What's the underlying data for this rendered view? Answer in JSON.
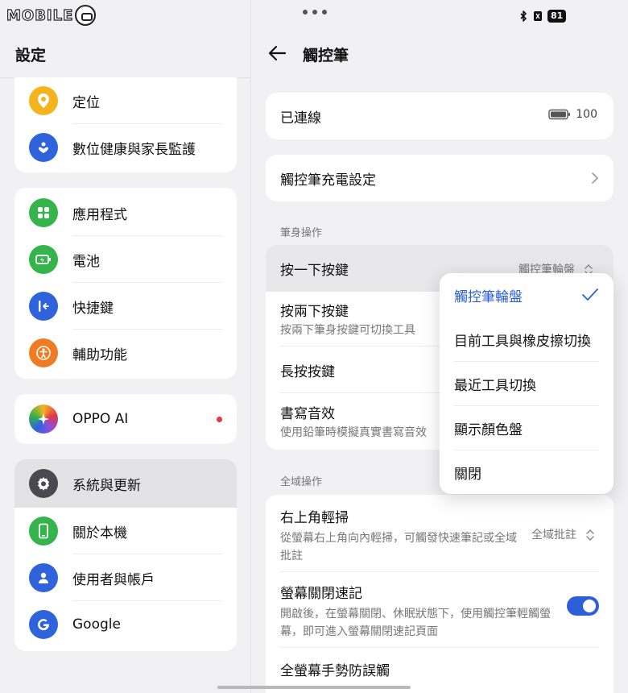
{
  "watermark": "MOBILE",
  "status": {
    "battery": "81"
  },
  "left": {
    "title": "設定",
    "groups": [
      {
        "items": [
          {
            "label": "定位",
            "icon": "location-icon",
            "color": "#f5b41e"
          },
          {
            "label": "數位健康與家長監護",
            "icon": "heart-icon",
            "color": "#2f63dc"
          }
        ]
      },
      {
        "items": [
          {
            "label": "應用程式",
            "icon": "apps-grid-icon",
            "color": "#34b44a"
          },
          {
            "label": "電池",
            "icon": "battery-icon",
            "color": "#34b44a"
          },
          {
            "label": "快捷鍵",
            "icon": "shortcut-icon",
            "color": "#2f63dc"
          },
          {
            "label": "輔助功能",
            "icon": "accessibility-icon",
            "color": "#f07b22"
          }
        ]
      },
      {
        "items": [
          {
            "label": "OPPO AI",
            "icon": "ai-sparkle-icon",
            "color": "#8a4fe0"
          }
        ]
      },
      {
        "items": [
          {
            "label": "系統與更新",
            "icon": "gear-icon",
            "color": "#4a4a4e"
          },
          {
            "label": "關於本機",
            "icon": "phone-icon",
            "color": "#34b44a"
          },
          {
            "label": "使用者與帳戶",
            "icon": "user-icon",
            "color": "#2f63dc"
          },
          {
            "label": "Google",
            "icon": "google-icon",
            "color": "#2f63dc"
          }
        ]
      }
    ]
  },
  "right": {
    "title": "觸控筆",
    "connected": {
      "label": "已連線",
      "battery": "100"
    },
    "charging": {
      "label": "觸控筆充電設定"
    },
    "section_pen": "筆身操作",
    "single_press": {
      "label": "按一下按鍵",
      "value": "觸控筆輪盤"
    },
    "double_press": {
      "label": "按兩下按鍵",
      "sub": "按兩下筆身按鍵可切換工具"
    },
    "long_press": {
      "label": "長按按鍵"
    },
    "writing_sound": {
      "label": "書寫音效",
      "sub": "使用鉛筆時模擬真實書寫音效"
    },
    "section_global": "全域操作",
    "corner_swipe": {
      "label": "右上角輕掃",
      "sub": "從螢幕右上角向內輕掃，可觸發快速筆記或全域批註",
      "value": "全域批註"
    },
    "screen_off": {
      "label": "螢幕關閉速記",
      "sub": "開啟後，在螢幕關閉、休眠狀態下，使用觸控筆輕觸螢幕，即可進入螢幕關閉速記頁面",
      "enabled": true
    },
    "palm": {
      "label": "全螢幕手勢防誤觸"
    }
  },
  "popup": {
    "options": [
      "觸控筆輪盤",
      "目前工具與橡皮擦切換",
      "最近工具切換",
      "顯示顏色盤",
      "關閉"
    ],
    "selected": 0,
    "accent": "#2d5fd8"
  }
}
